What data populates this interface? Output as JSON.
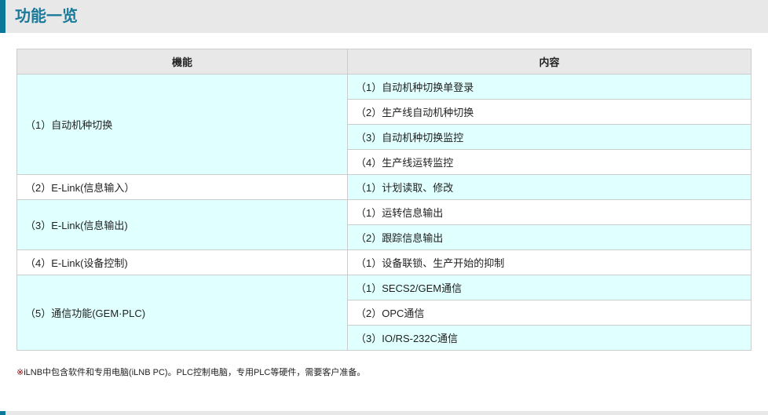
{
  "title": "功能一览",
  "table": {
    "headers": [
      "機能",
      "内容"
    ],
    "groups": [
      {
        "function": "（1）自动机种切换",
        "items": [
          "（1）自动机种切换单登录",
          "（2）生产线自动机种切换",
          "（3）自动机种切换监控",
          "（4）生产线运转监控"
        ]
      },
      {
        "function": "（2）E-Link(信息输入）",
        "items": [
          "（1）计划读取、修改"
        ]
      },
      {
        "function": "（3）E-Link(信息输出)",
        "items": [
          "（1）运转信息输出",
          "（2）跟踪信息输出"
        ]
      },
      {
        "function": "（4）E-Link(设备控制)",
        "items": [
          "（1）设备联锁、生产开始的抑制"
        ]
      },
      {
        "function": "（5）通信功能(GEM·PLC)",
        "items": [
          "（1）SECS2/GEM通信",
          "（2）OPC通信",
          "（3）IO/RS-232C通信"
        ]
      }
    ]
  },
  "note": {
    "mark": "※",
    "text": "iLNB中包含软件和专用电脑(iLNB PC)。PLC控制电脑，专用PLC等硬件，需要客户准备。"
  }
}
